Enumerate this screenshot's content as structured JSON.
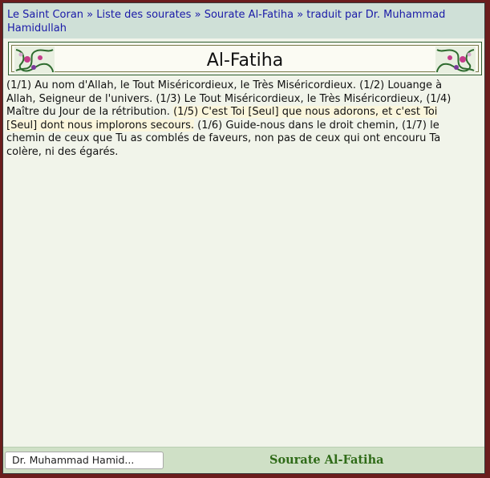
{
  "breadcrumb": {
    "items": [
      "Le Saint Coran",
      "Liste des sourates",
      "Sourate Al-Fatiha",
      "traduit par Dr. Muhammad Hamidullah"
    ],
    "separator": "»"
  },
  "title": "Al-Fatiha",
  "verses": [
    "(1/1) Au nom d'Allah, le Tout Miséricordieux, le Très Miséricordieux.",
    "(1/2) Louange à Allah, Seigneur de l'univers.",
    "(1/3) Le Tout Miséricordieux, le Très Miséricordieux,",
    "(1/4) Maître du Jour de la rétribution.",
    "(1/5) C'est Toi [Seul] que nous adorons, et c'est Toi [Seul] dont nous implorons secours.",
    "(1/6) Guide-nous dans le droit chemin,",
    "(1/7) le chemin de ceux que Tu as comblés de faveurs, non pas de ceux qui ont encouru Ta colère, ni des égarés."
  ],
  "highlighted_verse_index": 4,
  "footer": {
    "translator_selected": "Dr. Muhammad Hamid...",
    "sourate_name": "Sourate Al-Fatiha"
  },
  "colors": {
    "outer_border": "#6b1d1d",
    "page_background": "#f1f4ea",
    "breadcrumb_background": "#cfe0d7",
    "link": "#1a1aa8",
    "footer_background": "#cfe0c6",
    "sourate_title": "#2f6b18"
  }
}
